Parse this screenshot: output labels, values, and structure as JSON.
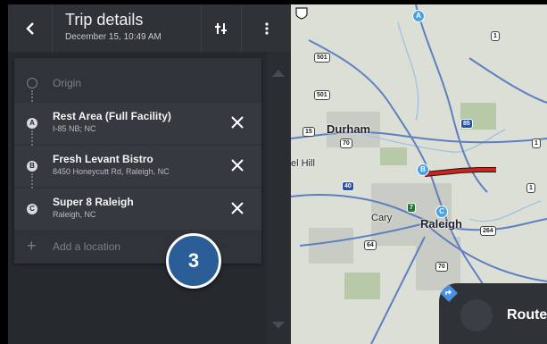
{
  "header": {
    "title": "Trip details",
    "subtitle": "December 15, 10:49 AM"
  },
  "origin": {
    "label": "Origin"
  },
  "stops": [
    {
      "letter": "A",
      "name": "Rest Area (Full Facility)",
      "address": "I-85 NB; NC"
    },
    {
      "letter": "B",
      "name": "Fresh Levant Bistro",
      "address": "8450 Honeycutt Rd, Raleigh, NC"
    },
    {
      "letter": "C",
      "name": "Super 8 Raleigh",
      "address": "Raleigh, NC"
    }
  ],
  "add_location": {
    "label": "Add a location"
  },
  "step_badge": "3",
  "map": {
    "cities": [
      "Durham",
      "el Hill",
      "Cary",
      "Raleigh"
    ],
    "shields": [
      "501",
      "501",
      "1",
      "70",
      "15",
      "85",
      "40",
      "7",
      "1",
      "264",
      "64",
      "70",
      "1"
    ],
    "pins": [
      "A",
      "B",
      "C"
    ]
  },
  "route_button": {
    "label": "Route"
  },
  "colors": {
    "panel_bg": "#26292e",
    "header_bg": "#2f3237",
    "badge_blue": "#2b5e96",
    "pin_blue": "#49a2e6",
    "route_red": "#d0211a"
  }
}
